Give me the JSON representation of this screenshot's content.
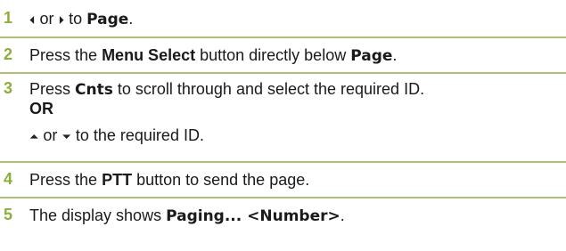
{
  "steps": [
    {
      "number": "1",
      "arrow_left": "⏴",
      "or": "or",
      "arrow_right": "⏵",
      "text": "to",
      "keyword": "Page",
      "end": "."
    },
    {
      "number": "2",
      "pre": "Press the",
      "button": "Menu Select",
      "mid": "button directly below",
      "keyword": "Page",
      "end": "."
    },
    {
      "number": "3",
      "pre": "Press",
      "keyword": "Cnts",
      "post": "to scroll through and select the required ID.",
      "or_label": "OR",
      "arrow_up": "⏶",
      "or": "or",
      "arrow_down": "⏷",
      "alt_text": "to the required ID."
    },
    {
      "number": "4",
      "pre": "Press the",
      "button": "PTT",
      "post": "button to send the page."
    },
    {
      "number": "5",
      "pre": "The display shows",
      "display": "Paging... <Number>",
      "end": "."
    }
  ],
  "colors": {
    "accent": "#8cae3c",
    "rule": "#a9c274"
  }
}
